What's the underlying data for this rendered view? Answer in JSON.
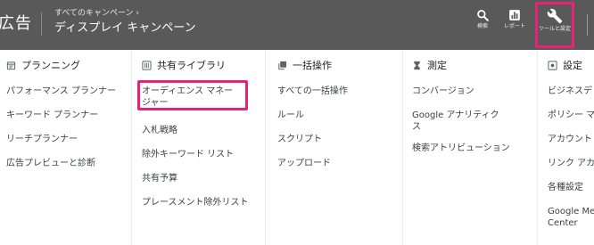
{
  "header": {
    "brand": "広告",
    "breadcrumb": "すべてのキャンペーン ›",
    "campaign_title": "ディスプレイ キャンペーン",
    "search_label": "検索",
    "report_label": "レポート",
    "tools_label": "ツールと設定"
  },
  "highlight_color": "#e8217a",
  "columns": [
    {
      "heading": "プランニング",
      "icon": "calendar-icon",
      "items": [
        "パフォーマンス プランナー",
        "キーワード プランナー",
        "リーチプランナー",
        "広告プレビューと診断"
      ]
    },
    {
      "heading": "共有ライブラリ",
      "icon": "library-icon",
      "items": [
        "オーディエンス マネージャー",
        "入札戦略",
        "除外キーワード リスト",
        "共有予算",
        "プレースメント除外リスト"
      ]
    },
    {
      "heading": "一括操作",
      "icon": "copy-icon",
      "items": [
        "すべての一括操作",
        "ルール",
        "スクリプト",
        "アップロード"
      ]
    },
    {
      "heading": "測定",
      "icon": "hourglass-icon",
      "items": [
        "コンバージョン",
        "Google アナリティクス",
        "検索アトリビューション"
      ]
    },
    {
      "heading": "設定",
      "icon": "settings-box-icon",
      "items": [
        "ビジネスデ",
        "ポリシー マ",
        "アカウント",
        "リンク アカ",
        "各種設定",
        "Google Mer Center"
      ]
    }
  ]
}
